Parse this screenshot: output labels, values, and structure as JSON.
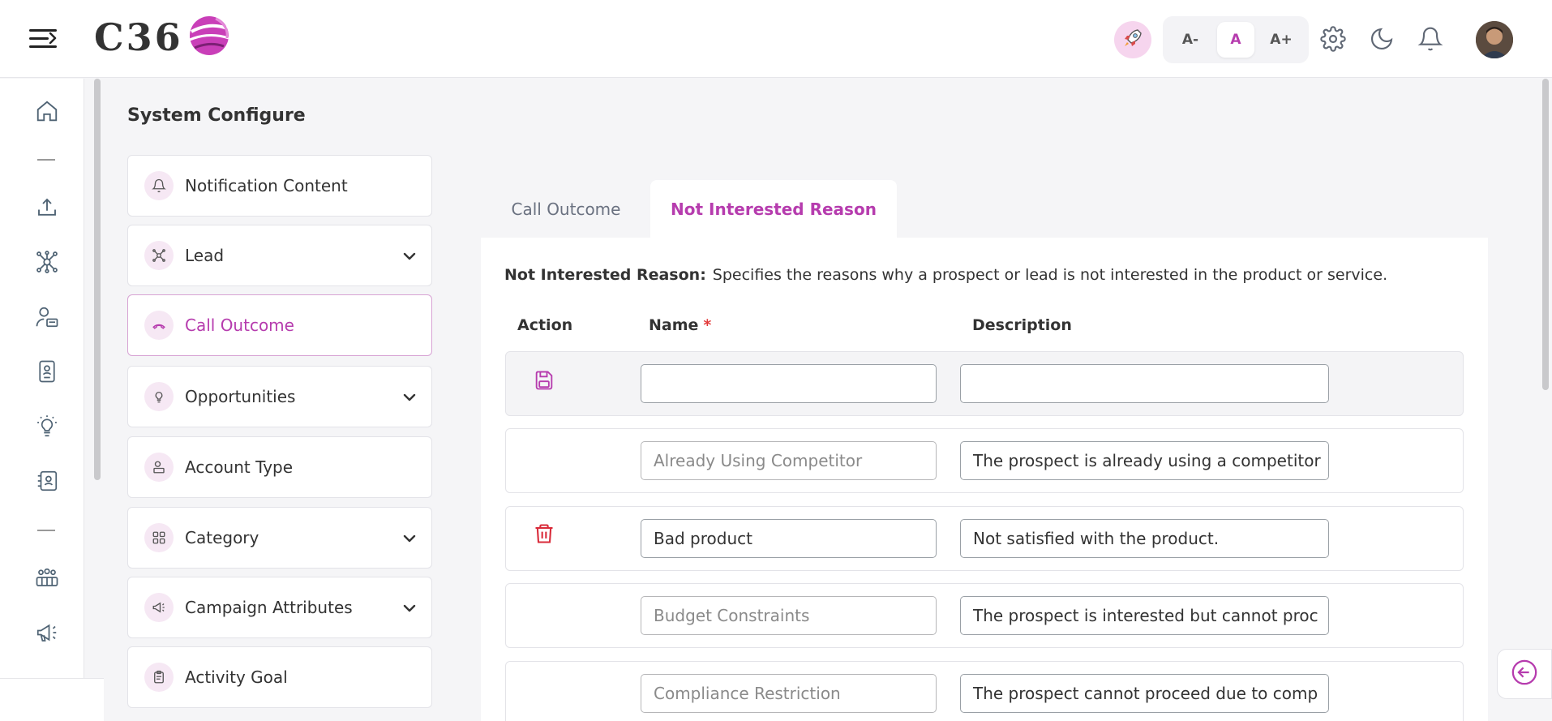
{
  "header": {
    "logo_text": "C36",
    "font_controls": [
      {
        "label": "A-"
      },
      {
        "label": "A",
        "active": true
      },
      {
        "label": "A+"
      }
    ],
    "icons": [
      "menu-icon",
      "rocket-icon",
      "gear-icon",
      "moon-icon",
      "bell-icon"
    ]
  },
  "rail": {
    "icons": [
      "home-icon",
      "upload-icon",
      "network-icon",
      "users-icon",
      "id-card-icon",
      "lightbulb-icon",
      "contacts-icon",
      "group-icon",
      "megaphone-icon"
    ]
  },
  "page": {
    "title": "System Configure"
  },
  "config_nav": [
    {
      "label": "Notification Content",
      "icon": "bell-icon",
      "chevron": false
    },
    {
      "label": "Lead",
      "icon": "network-icon",
      "chevron": true
    },
    {
      "label": "Call Outcome",
      "icon": "phone-hangup-icon",
      "chevron": false,
      "active": true
    },
    {
      "label": "Opportunities",
      "icon": "lightbulb-icon",
      "chevron": true
    },
    {
      "label": "Account Type",
      "icon": "user-card-icon",
      "chevron": false
    },
    {
      "label": "Category",
      "icon": "grid-icon",
      "chevron": true
    },
    {
      "label": "Campaign Attributes",
      "icon": "megaphone-icon",
      "chevron": true
    },
    {
      "label": "Activity Goal",
      "icon": "clipboard-icon",
      "chevron": false
    }
  ],
  "tabs": [
    {
      "label": "Call Outcome",
      "active": false
    },
    {
      "label": "Not Interested Reason",
      "active": true
    }
  ],
  "section": {
    "heading": "Not Interested Reason:",
    "description": "Specifies the reasons why a prospect or lead is not interested in the product or service."
  },
  "table": {
    "headers": {
      "action": "Action",
      "name": "Name",
      "required_mark": "*",
      "description": "Description"
    },
    "new_row": {
      "name": "",
      "description": ""
    },
    "rows": [
      {
        "name": "Already Using Competitor",
        "description": "The prospect is already using a competitor",
        "editable": false
      },
      {
        "name": "Bad product",
        "description": "Not satisfied with the product.",
        "editable": true
      },
      {
        "name": "Budget Constraints",
        "description": "The prospect is interested but cannot proc",
        "editable": false
      },
      {
        "name": "Compliance Restriction",
        "description": "The prospect cannot proceed due to comp",
        "editable": false
      }
    ]
  },
  "colors": {
    "accent": "#b63cae",
    "delete": "#d92b3a",
    "required": "#e23b3b"
  }
}
